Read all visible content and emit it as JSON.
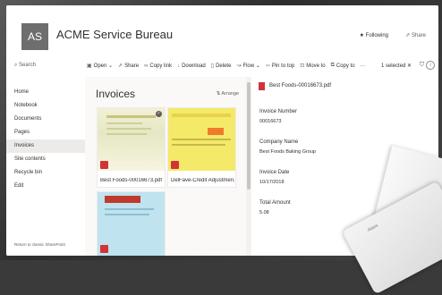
{
  "header": {
    "avatar_initials": "AS",
    "site_title": "ACME Service Bureau",
    "following_label": "★ Following",
    "share_label": "⇗ Share"
  },
  "commandbar": {
    "search_placeholder": "Search",
    "items": [
      {
        "icon": "open-icon",
        "label": "Open ⌄"
      },
      {
        "icon": "share-icon",
        "label": "Share"
      },
      {
        "icon": "link-icon",
        "label": "Copy link"
      },
      {
        "icon": "download-icon",
        "label": "Download"
      },
      {
        "icon": "trash-icon",
        "label": "Delete"
      },
      {
        "icon": "flow-icon",
        "label": "Flow ⌄"
      },
      {
        "icon": "pin-icon",
        "label": "Pin to top"
      },
      {
        "icon": "move-icon",
        "label": "Move to"
      },
      {
        "icon": "copy-icon",
        "label": "Copy to"
      },
      {
        "icon": "more-icon",
        "label": "···"
      }
    ],
    "selected_label": "1 selected ✕"
  },
  "nav": {
    "items": [
      {
        "label": "Home"
      },
      {
        "label": "Notebook"
      },
      {
        "label": "Documents"
      },
      {
        "label": "Pages"
      },
      {
        "label": "Invoices",
        "active": true
      },
      {
        "label": "Site contents"
      },
      {
        "label": "Recycle bin"
      },
      {
        "label": "Edit"
      }
    ],
    "return_label": "Return to classic SharePoint"
  },
  "library": {
    "title": "Invoices",
    "arrange_label": "Arrange",
    "files": [
      {
        "name": "Best Foods-00016673.pdf",
        "selected": true
      },
      {
        "name": "DelFave-Credit Adjustmen..."
      },
      {
        "name": ""
      }
    ]
  },
  "details": {
    "file_title": "Best Foods-00016673.pdf",
    "fields": [
      {
        "label": "Invoice Number",
        "value": "00016673"
      },
      {
        "label": "Company Name",
        "value": "Best Foods Baking Group"
      },
      {
        "label": "Invoice Date",
        "value": "10/17/2018"
      },
      {
        "label": "Total Amount",
        "value": "5.08"
      }
    ]
  },
  "device": {
    "logo": "Alaris"
  },
  "colors": {
    "accent": "#d13438",
    "nav_active": "#edebe9",
    "avatar_bg": "#6e6e6e"
  }
}
